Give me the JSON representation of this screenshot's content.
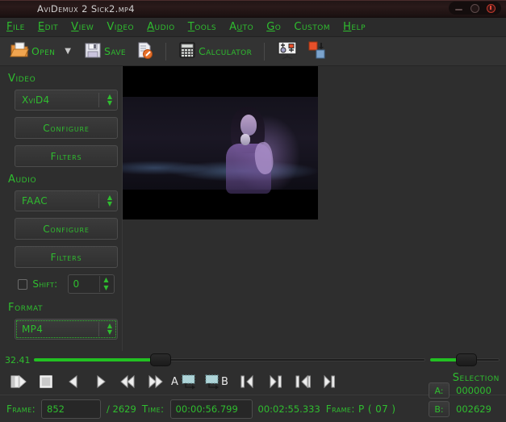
{
  "window": {
    "title": "AviDemux 2 Sick2.mp4",
    "controls": [
      {
        "name": "minimize",
        "icon": "minimize-icon"
      },
      {
        "name": "maximize",
        "icon": "maximize-icon"
      },
      {
        "name": "close",
        "icon": "close-icon"
      }
    ]
  },
  "menubar": {
    "items": [
      {
        "label": "File",
        "mnemonic": "F"
      },
      {
        "label": "Edit",
        "mnemonic": "E"
      },
      {
        "label": "View",
        "mnemonic": "V"
      },
      {
        "label": "Video",
        "mnemonic": "D"
      },
      {
        "label": "Audio",
        "mnemonic": "A"
      },
      {
        "label": "Tools",
        "mnemonic": "T"
      },
      {
        "label": "Auto",
        "mnemonic": "U"
      },
      {
        "label": "Go",
        "mnemonic": "G"
      },
      {
        "label": "Custom",
        "mnemonic": ""
      },
      {
        "label": "Help",
        "mnemonic": "H"
      }
    ]
  },
  "toolbar": {
    "open_label": "Open",
    "open_icon": "open-folder-icon",
    "open_dropdown_icon": "chevron-down-icon",
    "save_label": "Save",
    "save_icon": "floppy-disk-icon",
    "script_icon": "script-wrench-icon",
    "calculator_label": "Calculator",
    "calculator_icon": "calculator-icon",
    "jobs_icon": "jobs-board-icon",
    "priority_icon": "priority-queue-icon"
  },
  "sidebar": {
    "video": {
      "title": "Video",
      "codec": "XviD4",
      "configure_label": "Configure",
      "filters_label": "Filters"
    },
    "audio": {
      "title": "Audio",
      "codec": "FAAC",
      "configure_label": "Configure",
      "filters_label": "Filters",
      "shift_label": "Shift:",
      "shift_checked": false,
      "shift_value": "0"
    },
    "format": {
      "title": "Format",
      "container": "MP4",
      "focused": true
    }
  },
  "preview": {
    "name": "video-preview",
    "description": "Dark concert stage with a singer holding a microphone, blue stage lights"
  },
  "timeline": {
    "zoom_value": "32.41",
    "position_percent": 32.41,
    "selection_percent": 52
  },
  "transport": {
    "buttons": [
      {
        "name": "play-button",
        "icon": "play-icon"
      },
      {
        "name": "stop-button",
        "icon": "stop-icon"
      },
      {
        "name": "previous-frame-button",
        "icon": "prev-frame-icon"
      },
      {
        "name": "next-frame-button",
        "icon": "next-frame-icon"
      },
      {
        "name": "fast-rewind-button",
        "icon": "rewind-icon"
      },
      {
        "name": "fast-forward-button",
        "icon": "forward-icon"
      },
      {
        "name": "mark-a-button",
        "icon": "mark-a-icon",
        "label": "A"
      },
      {
        "name": "mark-b-button",
        "icon": "mark-b-icon",
        "label": "B"
      },
      {
        "name": "previous-keyframe-button",
        "icon": "prev-keyframe-icon"
      },
      {
        "name": "next-keyframe-button",
        "icon": "next-keyframe-icon"
      },
      {
        "name": "previous-black-frame-button",
        "icon": "prev-black-frame-icon"
      },
      {
        "name": "next-black-frame-button",
        "icon": "next-black-frame-icon"
      }
    ]
  },
  "selection": {
    "title": "Selection",
    "a_label": "A:",
    "a_value": "000000",
    "b_label": "B:",
    "b_value": "002629"
  },
  "status": {
    "frame_label": "Frame:",
    "frame_value": "852",
    "frame_total": "/ 2629",
    "time_label": "Time:",
    "time_value": "00:00:56.799",
    "time_total": "00:02:55.333",
    "frametype_label": "Frame: P ( 07 )"
  },
  "colors": {
    "accent_green": "#2fbd2f",
    "panel_bg": "#2e2e2e",
    "toolbar_bg": "#333333",
    "titlebar_bg": "#201414",
    "close_red": "#c0392b"
  }
}
